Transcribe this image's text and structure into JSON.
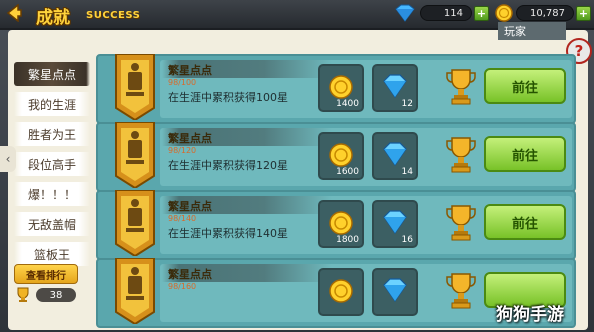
{
  "header": {
    "title": "成就",
    "title_en": "SUCCESS",
    "diamonds": "114",
    "gold": "10,787",
    "player_label": "玩家",
    "help_label": "?"
  },
  "sidebar": {
    "items": [
      {
        "label": "繁星点点",
        "active": true
      },
      {
        "label": "我的生涯",
        "active": false
      },
      {
        "label": "胜者为王",
        "active": false
      },
      {
        "label": "段位高手",
        "active": false
      },
      {
        "label": "爆！！！",
        "active": false
      },
      {
        "label": "无敌盖帽",
        "active": false
      },
      {
        "label": "篮板王",
        "active": false
      }
    ],
    "rank_button": "查看排行",
    "rank_count": "38"
  },
  "achievements": [
    {
      "name": "繁星点点",
      "progress": "98/100",
      "desc": "在生涯中累积获得100星",
      "gold": "1400",
      "diamonds": "12",
      "go": "前往"
    },
    {
      "name": "繁星点点",
      "progress": "98/120",
      "desc": "在生涯中累积获得120星",
      "gold": "1600",
      "diamonds": "14",
      "go": "前往"
    },
    {
      "name": "繁星点点",
      "progress": "98/140",
      "desc": "在生涯中累积获得140星",
      "gold": "1800",
      "diamonds": "16",
      "go": "前往"
    },
    {
      "name": "繁星点点",
      "progress": "98/160",
      "desc": "",
      "gold": "",
      "diamonds": "",
      "go": ""
    }
  ],
  "watermark": "狗狗手游",
  "colors": {
    "accent": "#ffd33c",
    "row": "#5aa7ad",
    "go": "#78c228",
    "panel": "#f2eedf"
  }
}
